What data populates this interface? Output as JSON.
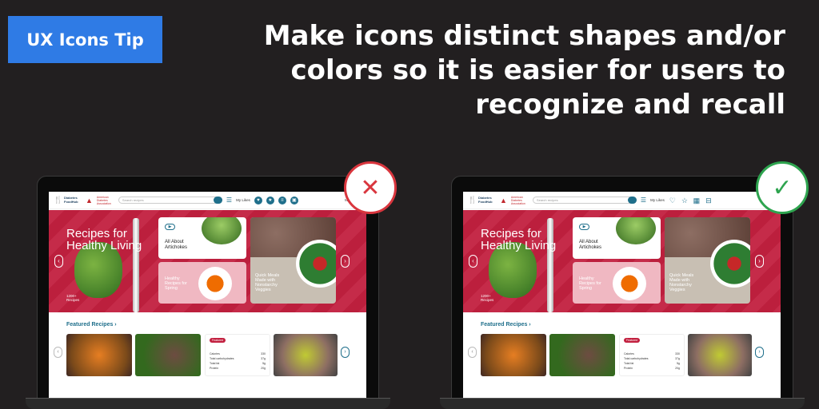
{
  "badge": {
    "label": "UX Icons Tip"
  },
  "headline": {
    "line1": "Make icons distinct shapes and/or",
    "line2": "colors so it is easier for users to",
    "line3": "recognize and recall"
  },
  "verdicts": {
    "bad": "✕",
    "good": "✓"
  },
  "site": {
    "logo_text": "Diabetes FoodHub",
    "partner_text": "American Diabetes Association",
    "search_placeholder": "Search recipes",
    "likes": "My Likes",
    "menu": "Menu",
    "hero": {
      "title": "Recipes for Healthy Living",
      "count_line1": "1200+",
      "count_line2": "Recipes",
      "card_artichoke": "All About Artichokes",
      "card_spring": "Healthy Recipes for Spring",
      "card_veggies": "Quick Meals Made with Nonstarchy Veggies"
    },
    "featured": {
      "title": "Featured Recipes ›",
      "tag": "Featured",
      "nutrition": [
        {
          "name": "Calories",
          "value": "330"
        },
        {
          "name": "Total carbohydrates",
          "value": "37g"
        },
        {
          "name": "Total fat",
          "value": "5g"
        },
        {
          "name": "Protein",
          "value": "20g"
        }
      ]
    }
  },
  "icons": {
    "bad": [
      "heart",
      "star",
      "list",
      "cart"
    ],
    "good": [
      "heart",
      "star",
      "list",
      "cart"
    ]
  },
  "colors": {
    "brand_blue": "#2f7be5",
    "hero_red": "#c2203f",
    "bad": "#d9363e",
    "good": "#2ea44f",
    "teal": "#1f6f8b"
  }
}
